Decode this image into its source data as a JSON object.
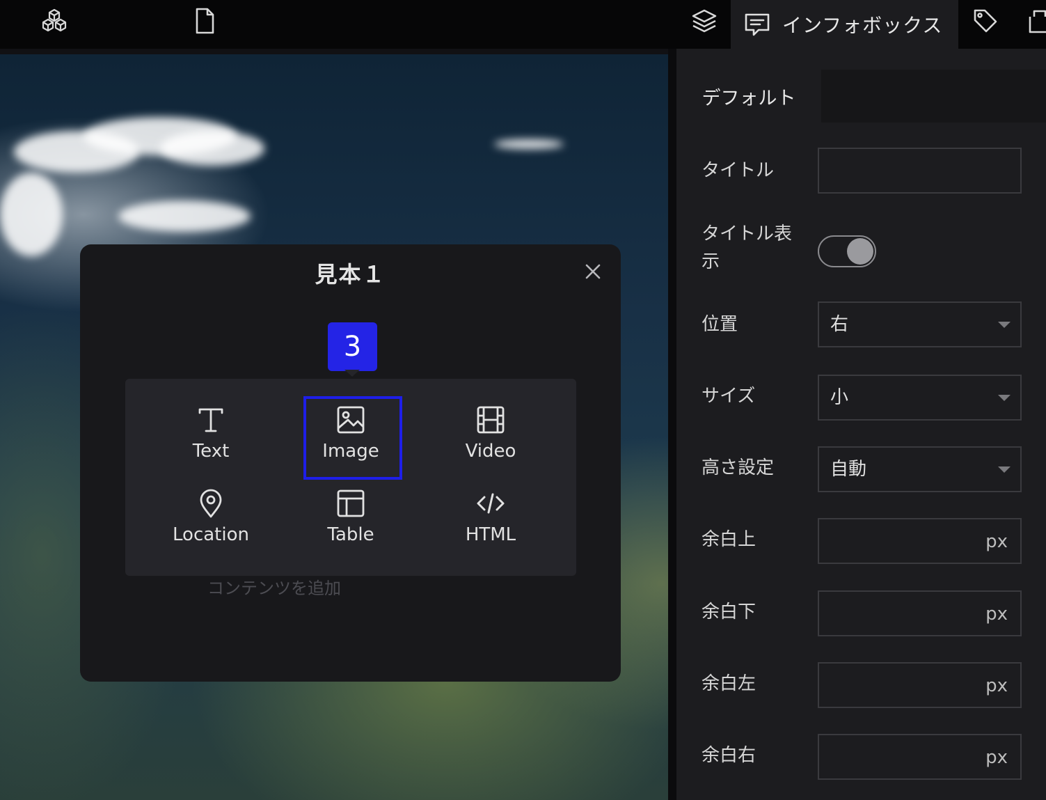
{
  "toolbar": {
    "icons": [
      "cube-cluster-icon",
      "file-icon",
      "layers-icon",
      "infobox-icon",
      "tag-icon",
      "export-icon"
    ],
    "active_tab_label": "インフォボックス"
  },
  "panel": {
    "tab_default": "デフォルト",
    "rows": {
      "title": {
        "label": "タイトル",
        "value": ""
      },
      "title_display": {
        "label_line1": "タイトル表",
        "label_line2": "示",
        "state": "on"
      },
      "position": {
        "label": "位置",
        "value": "右"
      },
      "size": {
        "label": "サイズ",
        "value": "小"
      },
      "height": {
        "label": "高さ設定",
        "value": "自動"
      },
      "margin_top": {
        "label": "余白上",
        "unit": "px"
      },
      "margin_bottom": {
        "label": "余白下",
        "unit": "px"
      },
      "margin_left": {
        "label": "余白左",
        "unit": "px"
      },
      "margin_right": {
        "label": "余白右",
        "unit": "px"
      }
    }
  },
  "modal": {
    "title": "見本１",
    "badge": "3",
    "placeholder": "コンテンツを追加",
    "options": [
      {
        "label": "Text",
        "icon": "text-icon"
      },
      {
        "label": "Image",
        "icon": "image-icon"
      },
      {
        "label": "Video",
        "icon": "video-icon"
      },
      {
        "label": "Location",
        "icon": "location-pin-icon"
      },
      {
        "label": "Table",
        "icon": "table-icon"
      },
      {
        "label": "HTML",
        "icon": "code-icon"
      }
    ]
  },
  "colors": {
    "highlight": "#1e1ee8",
    "badge": "#2424e6",
    "panel_bg": "#1c1c1f"
  }
}
